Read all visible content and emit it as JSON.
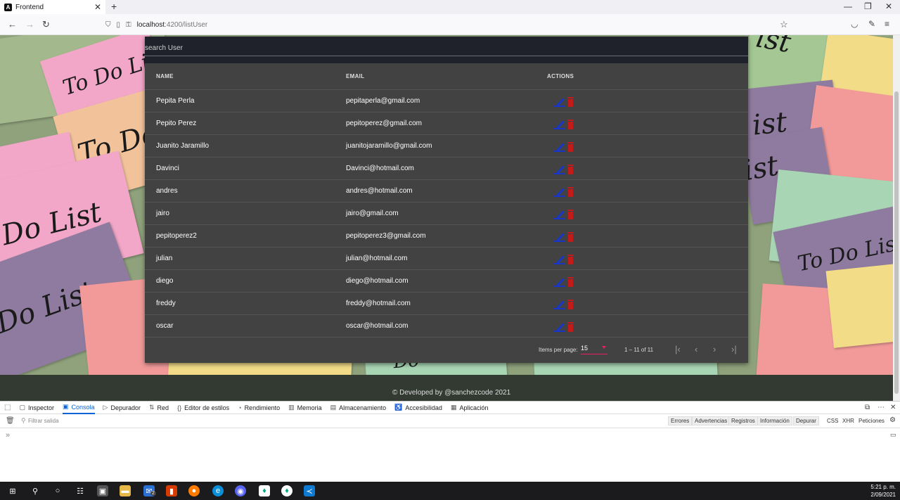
{
  "browser": {
    "tab_title": "Frontend",
    "url_host": "localhost",
    "url_path": ":4200/listUser"
  },
  "search": {
    "placeholder": "search User"
  },
  "table": {
    "headers": [
      "NAME",
      "EMAIL",
      "ACTIONS"
    ],
    "rows": [
      {
        "name": "Pepita Perla",
        "email": "pepitaperla@gmail.com"
      },
      {
        "name": "Pepito Perez",
        "email": "pepitoperez@gmail.com"
      },
      {
        "name": "Juanito Jaramillo",
        "email": "juanitojaramillo@gmail.com"
      },
      {
        "name": "Davinci",
        "email": "Davinci@hotmail.com"
      },
      {
        "name": "andres",
        "email": "andres@hotmail.com"
      },
      {
        "name": "jairo",
        "email": "jairo@gmail.com"
      },
      {
        "name": "pepitoperez2",
        "email": "pepitoperez3@gmail.com"
      },
      {
        "name": "julian",
        "email": "julian@hotmail.com"
      },
      {
        "name": "diego",
        "email": "diego@hotmail.com"
      },
      {
        "name": "freddy",
        "email": "freddy@hotmail.com"
      },
      {
        "name": "oscar",
        "email": "oscar@hotmail.com"
      }
    ]
  },
  "paginator": {
    "items_per_page_label": "Items per page:",
    "page_size": "15",
    "range": "1 – 11 of 11"
  },
  "footer": {
    "text": "© Developed by @sanchezcode 2021"
  },
  "devtools": {
    "tabs": [
      "Inspector",
      "Consola",
      "Depurador",
      "Red",
      "Editor de estilos",
      "Rendimiento",
      "Memoria",
      "Almacenamiento",
      "Accesibilidad",
      "Aplicación"
    ],
    "active_tab": "Consola",
    "filter_placeholder": "Filtrar salida",
    "filter_buttons": [
      "Errores",
      "Advertencias",
      "Registros",
      "Información",
      "Depurar"
    ],
    "extra_buttons": [
      "CSS",
      "XHR",
      "Peticiones"
    ]
  },
  "taskbar": {
    "time": "5:21 p. m.",
    "date": "2/09/2021",
    "mail_badge": "2"
  },
  "background_notes": [
    "To Do List",
    "To Do",
    "Do List",
    "Do List",
    "To Do List",
    "To Do",
    "ist",
    "ist",
    "ist",
    "Do"
  ],
  "colors": {
    "card_bg": "#424242",
    "search_bg": "#1f222a",
    "edit_icon": "#1736c9",
    "delete_icon": "#c41a1a",
    "accent": "#e91e63",
    "footer_bg": "#323a32"
  }
}
